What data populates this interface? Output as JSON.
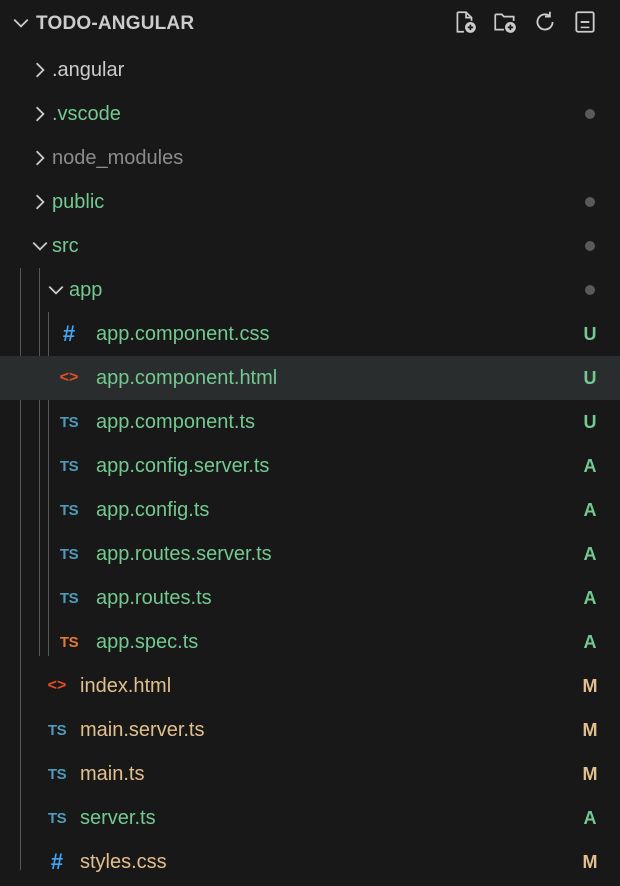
{
  "explorer": {
    "title": "TODO-ANGULAR",
    "actions": [
      "new-file-icon",
      "new-folder-icon",
      "refresh-icon",
      "collapse-all-icon"
    ]
  },
  "colors": {
    "background": "#181818",
    "selected_row": "#2a2d2e",
    "untracked_green": "#73c991",
    "modified_gold": "#e2c08d",
    "default_text": "#cccccc",
    "ignored_gray": "#8c8c8c",
    "ts_blue": "#519aba",
    "ts_spec_orange": "#e37933",
    "html_orange": "#e44d26",
    "css_blue": "#42a5f5",
    "dot_gray": "#5a5a5a"
  },
  "tree": [
    {
      "label": ".angular",
      "kind": "folder",
      "expanded": false
    },
    {
      "label": ".vscode",
      "kind": "folder",
      "expanded": false
    },
    {
      "label": "node_modules",
      "kind": "folder",
      "expanded": false
    },
    {
      "label": "public",
      "kind": "folder",
      "expanded": false
    },
    {
      "label": "src",
      "kind": "folder",
      "expanded": true
    },
    {
      "label": "app",
      "kind": "folder",
      "expanded": true
    },
    {
      "label": "app.component.css",
      "kind": "file",
      "icon": "#",
      "badge": "U"
    },
    {
      "label": "app.component.html",
      "kind": "file",
      "icon": "<>",
      "badge": "U",
      "selected": true
    },
    {
      "label": "app.component.ts",
      "kind": "file",
      "icon": "TS",
      "badge": "U"
    },
    {
      "label": "app.config.server.ts",
      "kind": "file",
      "icon": "TS",
      "badge": "A"
    },
    {
      "label": "app.config.ts",
      "kind": "file",
      "icon": "TS",
      "badge": "A"
    },
    {
      "label": "app.routes.server.ts",
      "kind": "file",
      "icon": "TS",
      "badge": "A"
    },
    {
      "label": "app.routes.ts",
      "kind": "file",
      "icon": "TS",
      "badge": "A"
    },
    {
      "label": "app.spec.ts",
      "kind": "file",
      "icon": "TS",
      "badge": "A"
    },
    {
      "label": "index.html",
      "kind": "file",
      "icon": "<>",
      "badge": "M"
    },
    {
      "label": "main.server.ts",
      "kind": "file",
      "icon": "TS",
      "badge": "M"
    },
    {
      "label": "main.ts",
      "kind": "file",
      "icon": "TS",
      "badge": "M"
    },
    {
      "label": "server.ts",
      "kind": "file",
      "icon": "TS",
      "badge": "A"
    },
    {
      "label": "styles.css",
      "kind": "file",
      "icon": "#",
      "badge": "M"
    }
  ]
}
